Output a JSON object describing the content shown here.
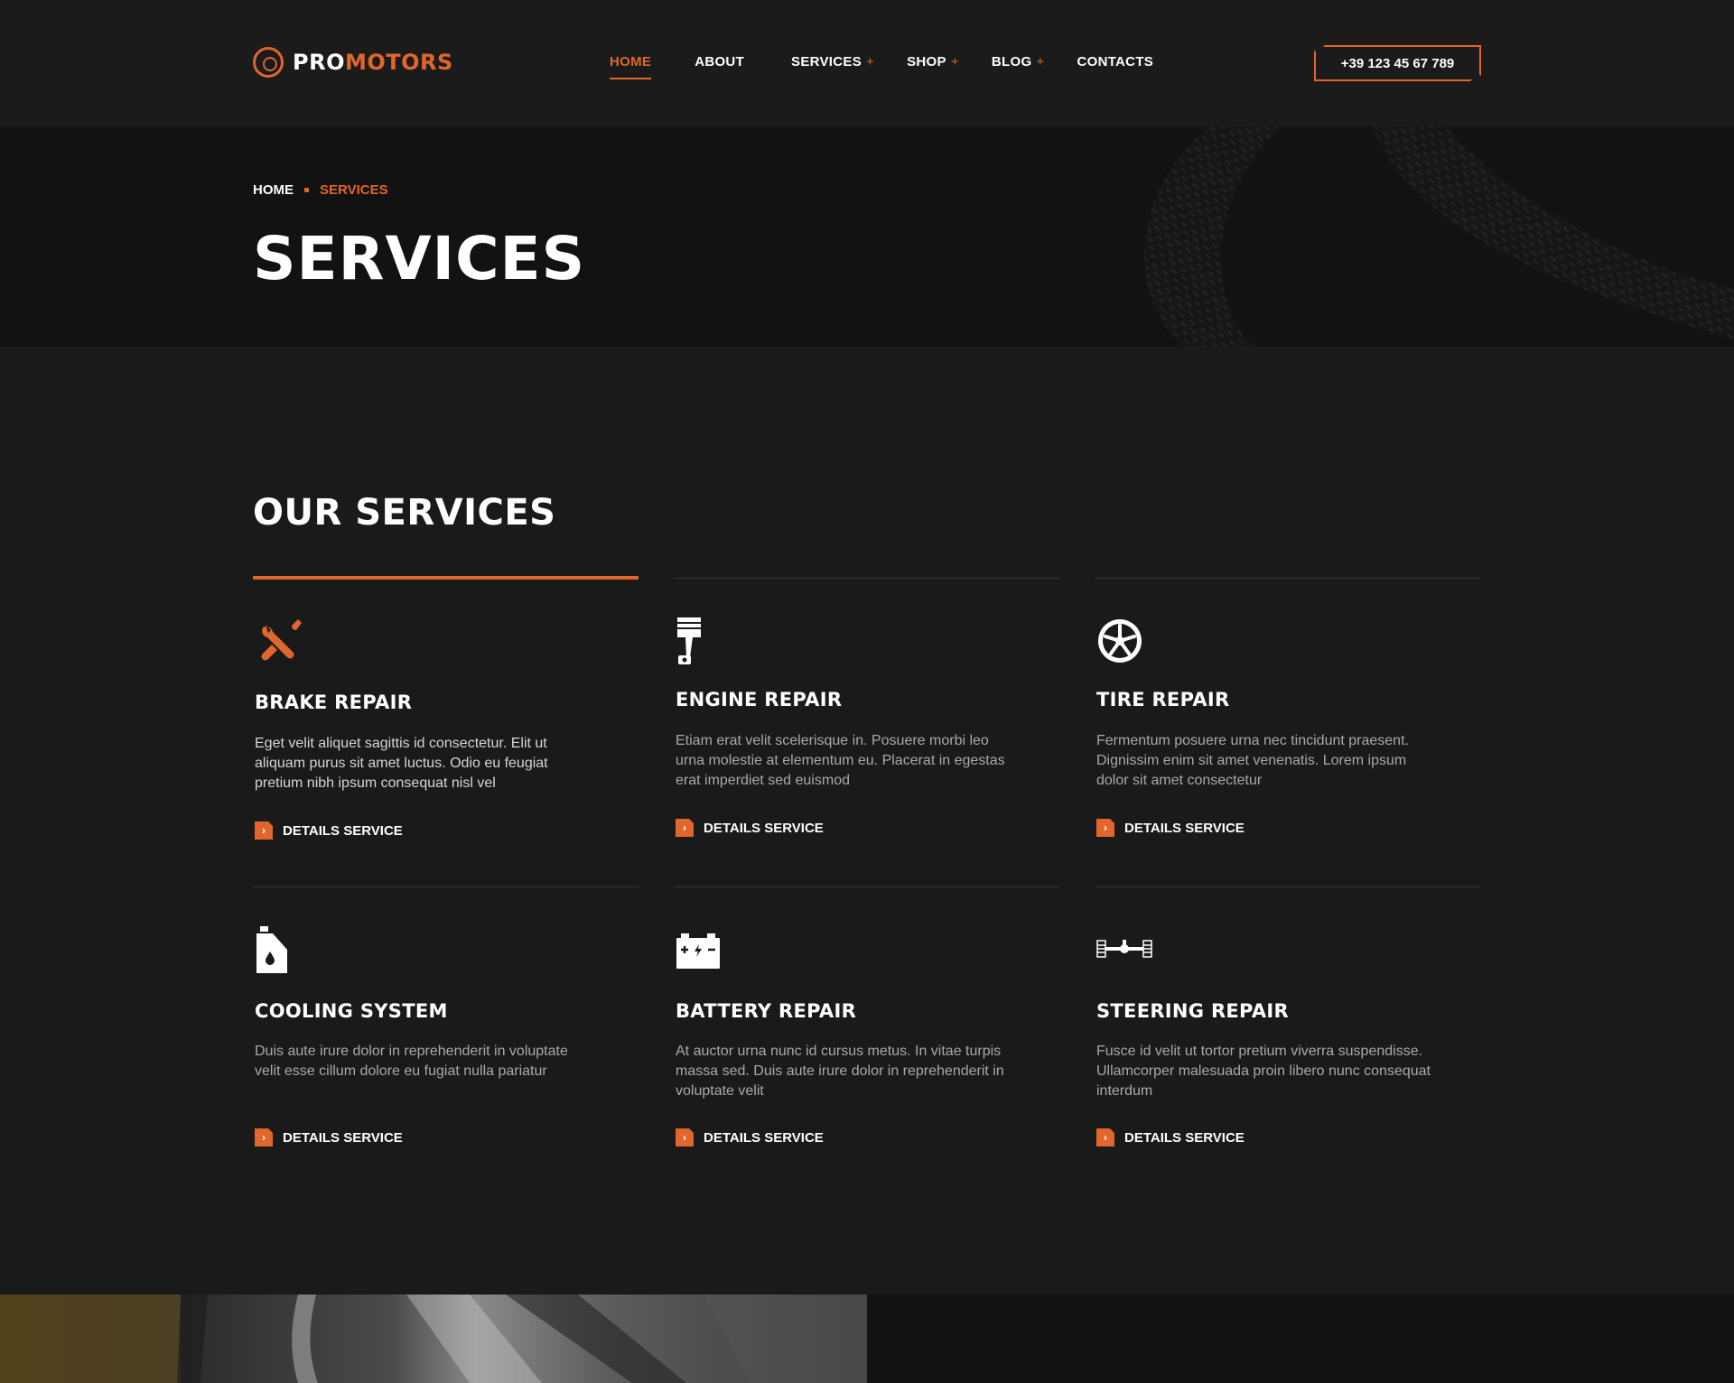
{
  "header": {
    "logo": {
      "part1": "PRO",
      "part2": "MOTORS"
    },
    "nav": [
      {
        "label": "HOME",
        "active": true,
        "has_sub": false
      },
      {
        "label": "ABOUT",
        "active": false,
        "has_sub": false
      },
      {
        "label": "SERVICES",
        "active": false,
        "has_sub": true
      },
      {
        "label": "SHOP",
        "active": false,
        "has_sub": true
      },
      {
        "label": "BLOG",
        "active": false,
        "has_sub": true
      },
      {
        "label": "CONTACTS",
        "active": false,
        "has_sub": false
      }
    ],
    "plus": "+",
    "phone": "+39 123 45 67 789"
  },
  "hero": {
    "breadcrumb": {
      "home": "HOME",
      "current": "SERVICES"
    },
    "title": "SERVICES"
  },
  "services_section": {
    "title": "OUR SERVICES",
    "link_label": "DETAILS SERVICE",
    "cards": [
      {
        "icon": "wrench-screwdriver-icon",
        "title": "BRAKE REPAIR",
        "desc": "Eget velit aliquet sagittis id consectetur. Elit ut aliquam purus sit amet luctus. Odio eu feugiat pretium nibh ipsum consequat nisl vel",
        "active": true
      },
      {
        "icon": "piston-icon",
        "title": "ENGINE REPAIR",
        "desc": "Etiam erat velit scelerisque in. Posuere morbi leo urna molestie at elementum eu. Placerat in egestas erat imperdiet sed euismod",
        "active": false
      },
      {
        "icon": "wheel-icon",
        "title": "TIRE REPAIR",
        "desc": "Fermentum posuere urna nec tincidunt praesent. Dignissim enim sit amet venenatis. Lorem ipsum dolor sit amet consectetur",
        "active": false
      },
      {
        "icon": "oil-canister-icon",
        "title": "COOLING SYSTEM",
        "desc": "Duis aute irure dolor in reprehenderit in voluptate velit esse cillum dolore eu fugiat nulla pariatur",
        "active": false
      },
      {
        "icon": "battery-icon",
        "title": "BATTERY REPAIR",
        "desc": "At auctor urna nunc id cursus metus. In vitae turpis massa sed. Duis aute irure dolor in reprehenderit in voluptate velit",
        "active": false
      },
      {
        "icon": "axle-icon",
        "title": "STEERING REPAIR",
        "desc": "Fusce id velit ut tortor pretium viverra suspendisse. Ullamcorper malesuada proin libero nunc consequat interdum",
        "active": false
      }
    ]
  },
  "colors": {
    "accent": "#e0662b",
    "background": "#1a1a1a",
    "header": "#1b1b1b",
    "hero": "#121212"
  }
}
